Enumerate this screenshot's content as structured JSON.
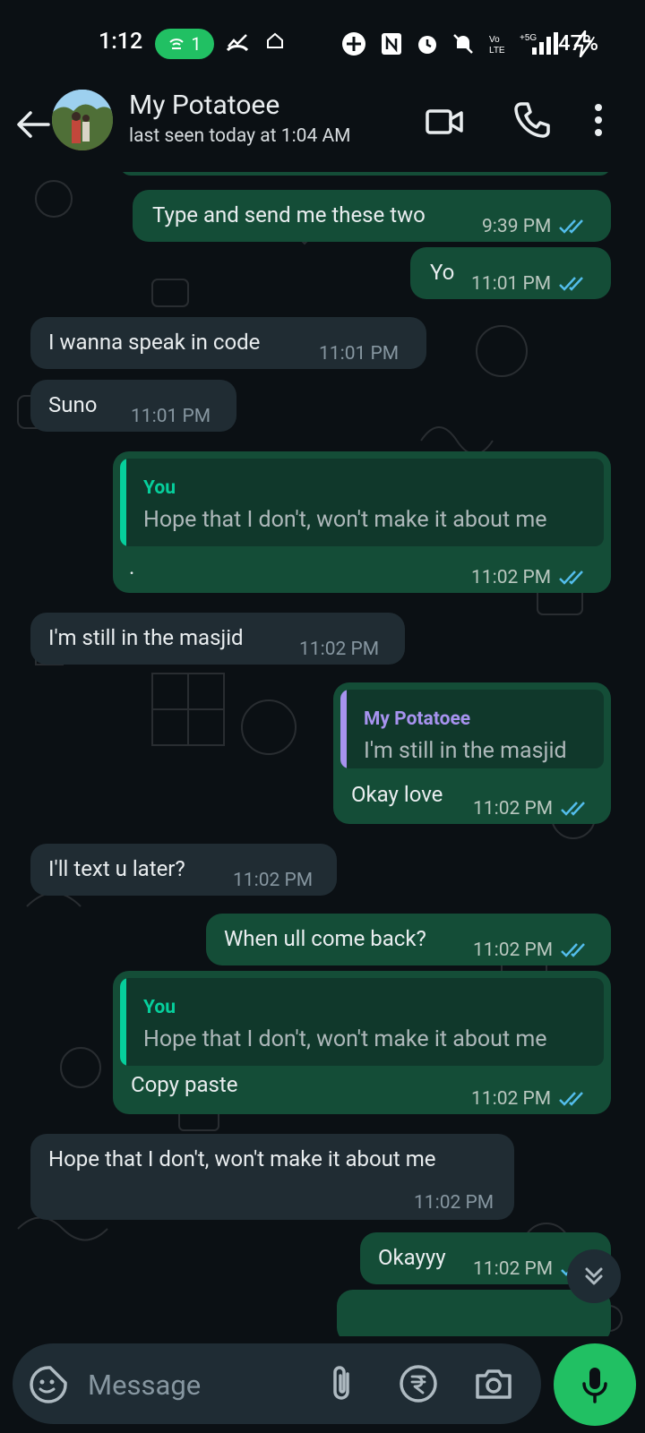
{
  "status_bar": {
    "time": "1:12",
    "hotspot_count": "1",
    "battery": "47%"
  },
  "header": {
    "contact_name": "My Potatoee",
    "last_seen": "last seen today at 1:04 AM"
  },
  "messages": [
    {
      "dir": "out",
      "text": "Type and send me these two",
      "time": "9:39 PM"
    },
    {
      "dir": "out",
      "text": "Yo",
      "time": "11:01 PM"
    },
    {
      "dir": "in",
      "text": "I wanna speak in code",
      "time": "11:01 PM"
    },
    {
      "dir": "in",
      "text": "Suno",
      "time": "11:01 PM"
    },
    {
      "dir": "out",
      "quote_name": "You",
      "quote_text": "Hope that I don't, won't make it about me",
      "text": ".",
      "time": "11:02 PM"
    },
    {
      "dir": "in",
      "text": "I'm still in the masjid",
      "time": "11:02 PM"
    },
    {
      "dir": "out",
      "quote_name": "My Potatoee",
      "quote_text": "I'm still in the masjid",
      "text": "Okay love",
      "time": "11:02 PM"
    },
    {
      "dir": "in",
      "text": "I'll text u later?",
      "time": "11:02 PM"
    },
    {
      "dir": "out",
      "text": "When ull come back?",
      "time": "11:02 PM"
    },
    {
      "dir": "out",
      "quote_name": "You",
      "quote_text": "Hope that I don't, won't make it about me",
      "text": "Copy paste",
      "time": "11:02 PM"
    },
    {
      "dir": "in",
      "text": "Hope that I don't, won't make it about me",
      "time": "11:02 PM"
    },
    {
      "dir": "out",
      "text": "Okayyy",
      "time": "11:02 PM"
    }
  ],
  "composer": {
    "placeholder": "Message"
  },
  "colors": {
    "outgoing_bubble": "#144d37",
    "incoming_bubble": "#202c33",
    "accent_green": "#21c063",
    "read_ticks": "#53bdeb"
  }
}
